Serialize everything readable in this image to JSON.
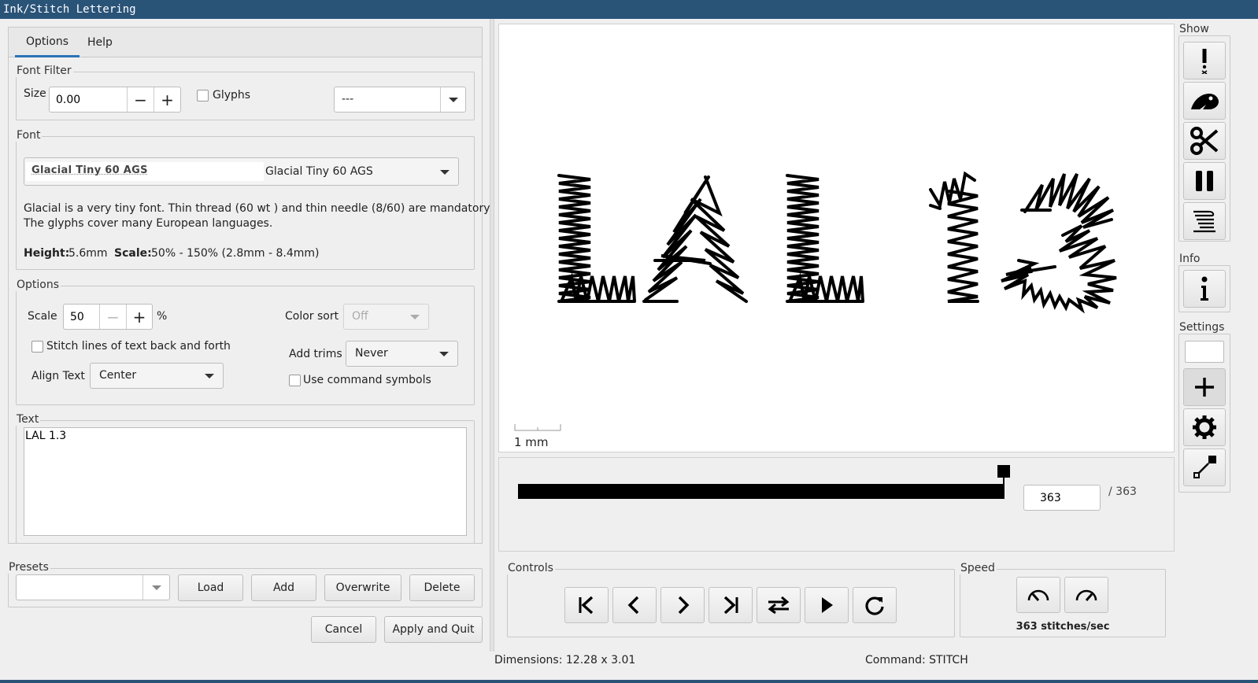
{
  "window": {
    "title": "Ink/Stitch Lettering"
  },
  "tabs": [
    {
      "label": "Options"
    },
    {
      "label": "Help"
    }
  ],
  "font_filter": {
    "legend": "Font Filter",
    "size_label": "Size",
    "size_value": "0.00",
    "glyphs_label": "Glyphs",
    "select_value": "---"
  },
  "font": {
    "legend": "Font",
    "preview_text": "Glacial Tiny 60 AGS",
    "name": "Glacial Tiny 60 AGS",
    "description_1": "Glacial is a very tiny font. Thin thread (60 wt ) and thin needle (8/60) are mandatory.",
    "description_2": "The glyphs cover many European languages.",
    "height_label": "Height:",
    "height_value": "5.6mm",
    "scale_label": "Scale:",
    "scale_value": "50% - 150% (2.8mm - 8.4mm)"
  },
  "options": {
    "legend": "Options",
    "scale_label": "Scale",
    "scale_value": "50",
    "scale_unit": "%",
    "color_sort_label": "Color sort",
    "color_sort_value": "Off",
    "back_forth_label": "Stitch lines of text back and forth",
    "add_trims_label": "Add trims",
    "add_trims_value": "Never",
    "align_label": "Align Text",
    "align_value": "Center",
    "command_symbols_label": "Use command symbols"
  },
  "text": {
    "legend": "Text",
    "value": "LAL 1.3"
  },
  "presets": {
    "legend": "Presets",
    "load": "Load",
    "add": "Add",
    "overwrite": "Overwrite",
    "delete": "Delete"
  },
  "actions": {
    "cancel": "Cancel",
    "apply": "Apply and Quit"
  },
  "preview": {
    "scale_label": "1 mm"
  },
  "slider": {
    "current": "363",
    "total": "/ 363",
    "progress": 1.0
  },
  "controls": {
    "legend": "Controls"
  },
  "speed": {
    "legend": "Speed",
    "value": "363 stitches/sec"
  },
  "sidebar": {
    "show": "Show",
    "info": "Info",
    "settings": "Settings"
  },
  "status": {
    "dimensions": "Dimensions: 12.28 x 3.01",
    "command": "Command: STITCH"
  },
  "colors": {
    "titlebar": "#2a5378",
    "tab_underline": "#2a72b8",
    "stitch": "#000000"
  }
}
